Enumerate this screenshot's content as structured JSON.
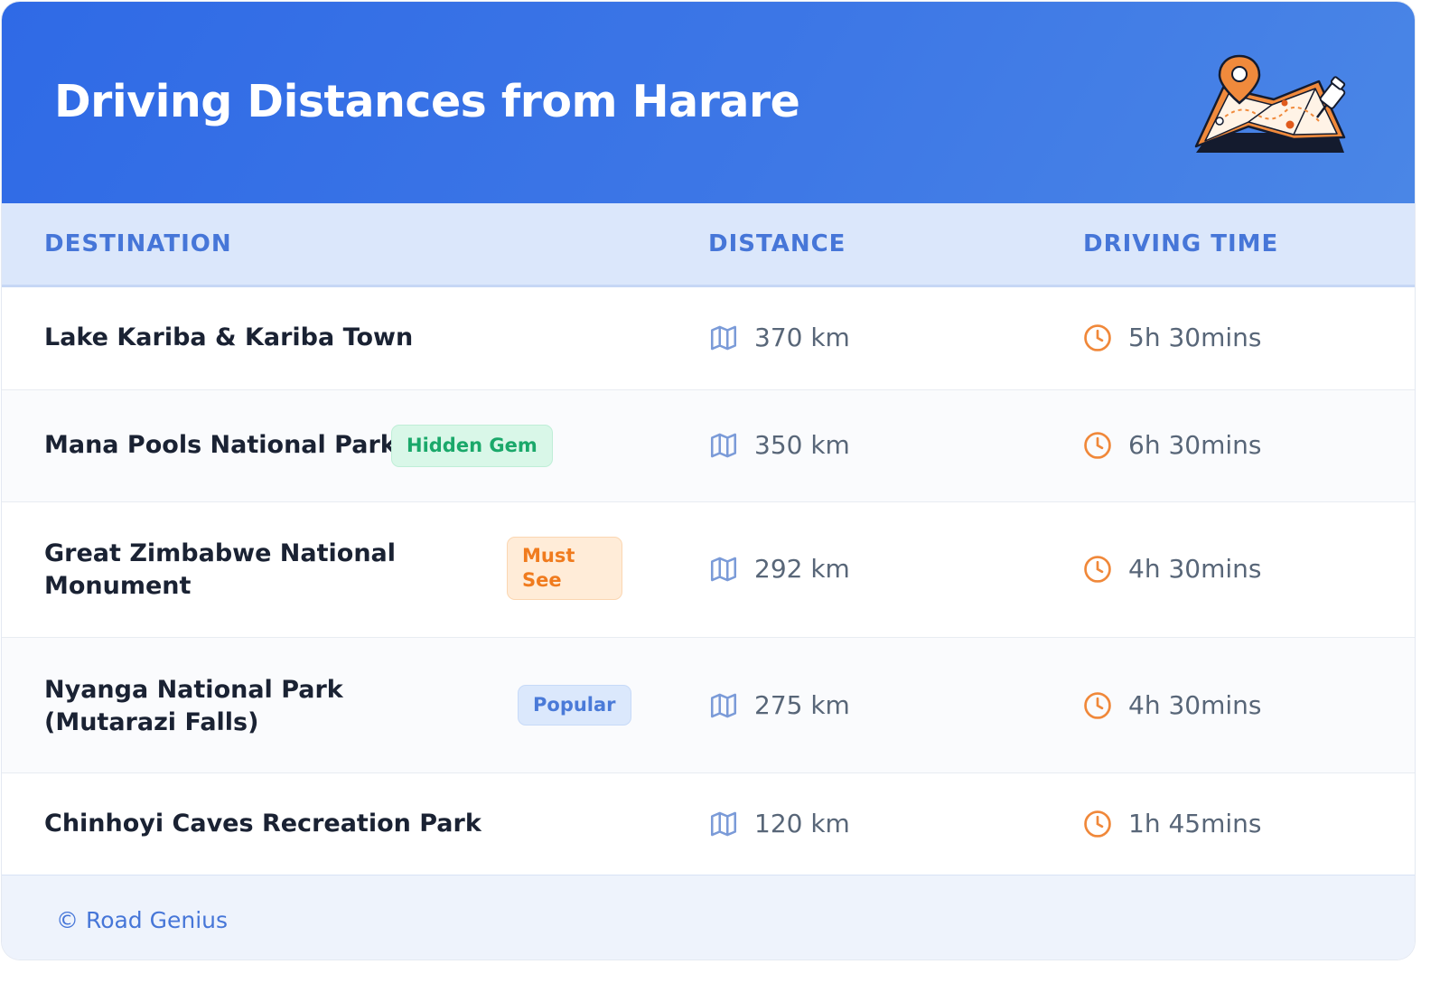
{
  "header": {
    "title": "Driving Distances from Harare",
    "illustration_icon": "map-with-pin-icon",
    "gradient_colors": [
      "#2f6ae6",
      "#4a86e6"
    ]
  },
  "table": {
    "columns": [
      "DESTINATION",
      "DISTANCE",
      "DRIVING TIME"
    ],
    "distance_icon": "map-icon",
    "time_icon": "clock-icon",
    "rows": [
      {
        "destination": "Lake Kariba & Kariba Town",
        "badge": "",
        "badge_color": "",
        "distance": "370 km",
        "time": "5h 30mins"
      },
      {
        "destination": "Mana Pools National Park",
        "badge": "Hidden Gem",
        "badge_color": "green",
        "distance": "350 km",
        "time": "6h 30mins"
      },
      {
        "destination": "Great Zimbabwe National Monument",
        "badge": "Must See",
        "badge_color": "orange",
        "distance": "292 km",
        "time": "4h 30mins"
      },
      {
        "destination": "Nyanga National Park (Mutarazi Falls)",
        "badge": "Popular",
        "badge_color": "blue",
        "distance": "275 km",
        "time": "4h 30mins"
      },
      {
        "destination": "Chinhoyi Caves Recreation Park",
        "badge": "",
        "badge_color": "",
        "distance": "120 km",
        "time": "1h 45mins"
      }
    ]
  },
  "footer": {
    "credit": "© Road Genius"
  },
  "colors": {
    "accent": "#4676d8",
    "clock": "#f0883a",
    "map_icon": "#7b9bd8"
  }
}
